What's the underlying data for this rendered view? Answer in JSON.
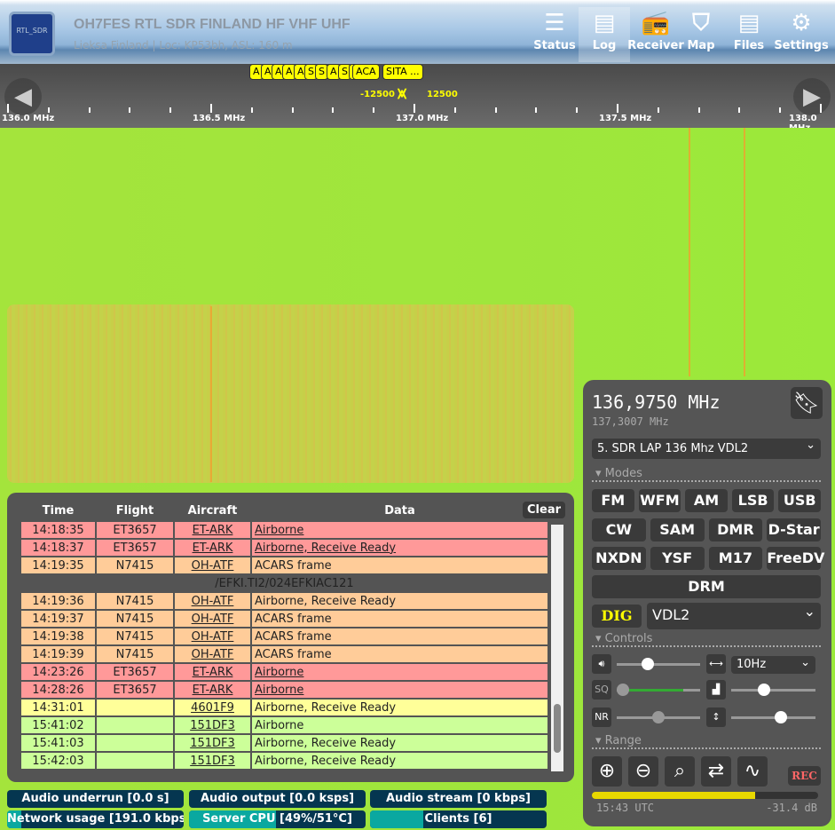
{
  "header": {
    "logo_text": "RTL_SDR",
    "title": "OH7FES RTL SDR FINLAND HF VHF UHF",
    "subtitle": "Lieksa Finland | Loc: KP53bh, ASL: 160 m",
    "nav": [
      {
        "label": "Status",
        "icon": "status-icon"
      },
      {
        "label": "Log",
        "icon": "log-icon"
      },
      {
        "label": "Receiver",
        "icon": "radio-icon"
      },
      {
        "label": "Map",
        "icon": "map-icon"
      },
      {
        "label": "Files",
        "icon": "files-icon"
      },
      {
        "label": "Settings",
        "icon": "gear-icon"
      }
    ]
  },
  "scale": {
    "labels": [
      "136.0 MHz",
      "136.5 MHz",
      "137.0 MHz",
      "137.5 MHz",
      "138.0 MHz"
    ],
    "bookmarks": [
      "A",
      "A",
      "A",
      "A",
      "A",
      "S",
      "S",
      "A",
      "S",
      "S",
      "ACA",
      "SITA ..."
    ],
    "offset_low": "-12500",
    "offset_high": "12500"
  },
  "log": {
    "headers": [
      "Time",
      "Flight",
      "Aircraft",
      "Data"
    ],
    "clear": "Clear",
    "rows": [
      {
        "t": "14:18:35",
        "f": "ET3657",
        "a": "ET-ARK",
        "d": "Airborne",
        "c": "red",
        "du": true
      },
      {
        "t": "14:18:37",
        "f": "ET3657",
        "a": "ET-ARK",
        "d": "Airborne, Receive Ready",
        "c": "red",
        "du": true
      },
      {
        "t": "14:19:35",
        "f": "N7415",
        "a": "OH-ATF",
        "d": "ACARS frame",
        "c": "org"
      },
      {
        "msg": "/EFKI.TI2/024EFKIAC121"
      },
      {
        "t": "14:19:36",
        "f": "N7415",
        "a": "OH-ATF",
        "d": "Airborne, Receive Ready",
        "c": "org"
      },
      {
        "t": "14:19:37",
        "f": "N7415",
        "a": "OH-ATF",
        "d": "ACARS frame",
        "c": "org"
      },
      {
        "t": "14:19:38",
        "f": "N7415",
        "a": "OH-ATF",
        "d": "ACARS frame",
        "c": "org"
      },
      {
        "t": "14:19:39",
        "f": "N7415",
        "a": "OH-ATF",
        "d": "ACARS frame",
        "c": "org"
      },
      {
        "t": "14:23:26",
        "f": "ET3657",
        "a": "ET-ARK",
        "d": "Airborne",
        "c": "red",
        "du": true
      },
      {
        "t": "14:28:26",
        "f": "ET3657",
        "a": "ET-ARK",
        "d": "Airborne",
        "c": "red",
        "du": true
      },
      {
        "t": "14:31:01",
        "f": "",
        "a": "4601F9",
        "d": "Airborne, Receive Ready",
        "c": "yel"
      },
      {
        "t": "15:41:02",
        "f": "",
        "a": "151DF3",
        "d": "Airborne",
        "c": "grn"
      },
      {
        "t": "15:41:03",
        "f": "",
        "a": "151DF3",
        "d": "Airborne, Receive Ready",
        "c": "grn"
      },
      {
        "t": "15:42:03",
        "f": "",
        "a": "151DF3",
        "d": "Airborne, Receive Ready",
        "c": "grn"
      }
    ]
  },
  "panel": {
    "frequency": "136,9750 MHz",
    "lo_frequency": "137,3007 MHz",
    "profile": "5. SDR LAP 136 Mhz VDL2",
    "modes_label": "Modes",
    "modes": [
      [
        "FM",
        "WFM",
        "AM",
        "LSB",
        "USB"
      ],
      [
        "CW",
        "SAM",
        "DMR",
        "D-Star"
      ],
      [
        "NXDN",
        "YSF",
        "M17",
        "FreeDV"
      ],
      [
        "DRM"
      ]
    ],
    "dig": "DIG",
    "dig_mode": "VDL2",
    "controls_label": "Controls",
    "step": "10Hz",
    "sq": "SQ",
    "nr": "NR",
    "range_label": "Range",
    "rec": "REC",
    "volume": 0.35,
    "squelch": 0.0,
    "nr_level": 0.5,
    "wf_min": 0.37,
    "wf_max": 0.6,
    "signal_level": 0.72,
    "time": "15:43 UTC",
    "level": "-31.4 dB"
  },
  "status": [
    {
      "label": "Audio underrun [0.0 s]",
      "fill": 0
    },
    {
      "label": "Audio output [0.0 ksps]",
      "fill": 0
    },
    {
      "label": "Audio stream [0 kbps]",
      "fill": 0
    },
    {
      "label": "Network usage [191.0 kbps]",
      "fill": 0.08
    },
    {
      "label": "Server CPU [49%/51°C]",
      "fill": 0.49
    },
    {
      "label": "Clients [6]",
      "fill": 0.3
    }
  ]
}
